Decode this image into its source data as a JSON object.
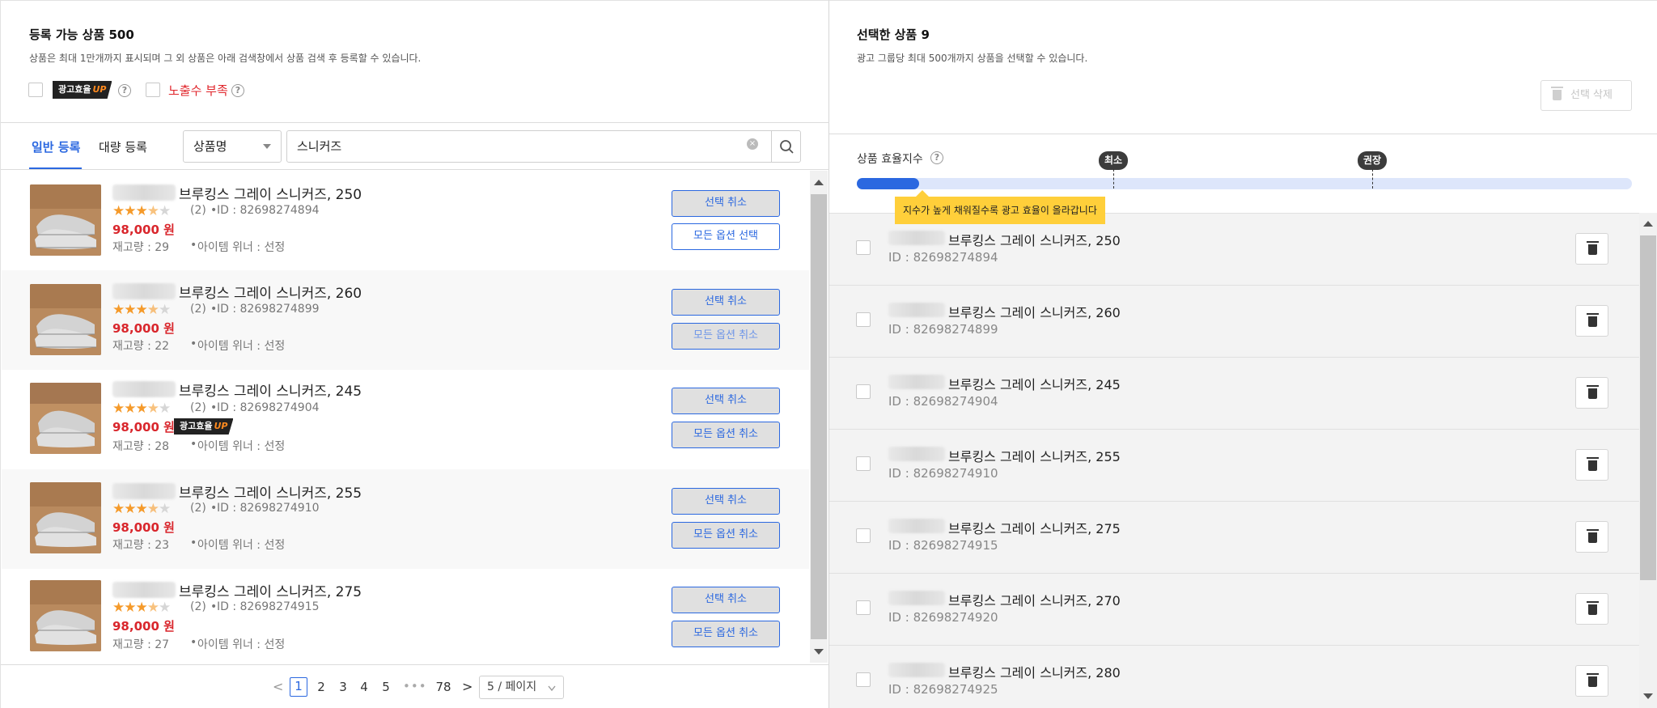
{
  "left": {
    "title": "등록 가능 상품 500",
    "desc": "상품은 최대 1만개까지 표시되며 그 외 상품은 아래 검색창에서 상품 검색 후 등록할 수 있습니다.",
    "badge_text": "광고효율",
    "badge_up": "UP",
    "low_exposure_label": "노출수 부족",
    "help_glyph": "?",
    "tabs": [
      {
        "label": "일반 등록",
        "active": true
      },
      {
        "label": "대량 등록",
        "active": false
      }
    ],
    "search_field_select": "상품명",
    "search_value": "스니커즈",
    "clear_glyph": "×"
  },
  "products": [
    {
      "name": "브루킹스 그레이 스니커즈, 250",
      "rating": 3.5,
      "reviews": "(2)",
      "id": "ID : 82698274894",
      "price": "98,000 원",
      "stock": "재고량 : 29",
      "winner": "아이템 위너 : 선정",
      "badge": false,
      "btn1": "선택 취소",
      "btn2": "모든 옵션 선택",
      "btn2_style": "outline"
    },
    {
      "name": "브루킹스 그레이 스니커즈, 260",
      "rating": 3.5,
      "reviews": "(2)",
      "id": "ID : 82698274899",
      "price": "98,000 원",
      "stock": "재고량 : 22",
      "winner": "아이템 위너 : 선정",
      "badge": false,
      "btn1": "선택 취소",
      "btn2": "모든 옵션 취소",
      "btn2_style": "cancel-light"
    },
    {
      "name": "브루킹스 그레이 스니커즈, 245",
      "rating": 3.5,
      "reviews": "(2)",
      "id": "ID : 82698274904",
      "price": "98,000 원",
      "stock": "재고량 : 28",
      "winner": "아이템 위너 : 선정",
      "badge": true,
      "btn1": "선택 취소",
      "btn2": "모든 옵션 취소",
      "btn2_style": "cancel"
    },
    {
      "name": "브루킹스 그레이 스니커즈, 255",
      "rating": 3.5,
      "reviews": "(2)",
      "id": "ID : 82698274910",
      "price": "98,000 원",
      "stock": "재고량 : 23",
      "winner": "아이템 위너 : 선정",
      "badge": false,
      "btn1": "선택 취소",
      "btn2": "모든 옵션 취소",
      "btn2_style": "cancel"
    },
    {
      "name": "브루킹스 그레이 스니커즈, 275",
      "rating": 3.5,
      "reviews": "(2)",
      "id": "ID : 82698274915",
      "price": "98,000 원",
      "stock": "재고량 : 27",
      "winner": "아이템 위너 : 선정",
      "badge": false,
      "btn1": "선택 취소",
      "btn2": "모든 옵션 취소",
      "btn2_style": "cancel"
    }
  ],
  "pagination": {
    "prev": "<",
    "next": ">",
    "pages": [
      "1",
      "2",
      "3",
      "4",
      "5"
    ],
    "current": "1",
    "ellipsis": "•••",
    "last": "78",
    "page_size": "5 / 페이지"
  },
  "right": {
    "title": "선택한 상품 9",
    "desc": "광고 그룹당 최대 500개까지 상품을 선택할 수 있습니다.",
    "delete_selected": "선택 삭제",
    "score_label": "상품 효율지수",
    "score_fraction": 0.08,
    "marker_min": "최소",
    "marker_recommended": "권장",
    "tooltip": "지수가 높게 채워질수록 광고 효율이 올라갑니다"
  },
  "selected": [
    {
      "name": "브루킹스 그레이 스니커즈, 250",
      "id": "ID : 82698274894"
    },
    {
      "name": "브루킹스 그레이 스니커즈, 260",
      "id": "ID : 82698274899"
    },
    {
      "name": "브루킹스 그레이 스니커즈, 245",
      "id": "ID : 82698274904"
    },
    {
      "name": "브루킹스 그레이 스니커즈, 255",
      "id": "ID : 82698274910"
    },
    {
      "name": "브루킹스 그레이 스니커즈, 275",
      "id": "ID : 82698274915"
    },
    {
      "name": "브루킹스 그레이 스니커즈, 270",
      "id": "ID : 82698274920"
    },
    {
      "name": "브루킹스 그레이 스니커즈, 280",
      "id": "ID : 82698274925"
    }
  ],
  "colors": {
    "accent": "#2b68e0",
    "price": "#d9262c",
    "star": "#f59a2a",
    "tooltip": "#ffcf3a"
  },
  "icons": {
    "search": "search-icon",
    "trash": "trash-icon",
    "help": "help-circle-icon",
    "clear": "clear-circle-icon",
    "caret": "chevron-down-icon"
  }
}
